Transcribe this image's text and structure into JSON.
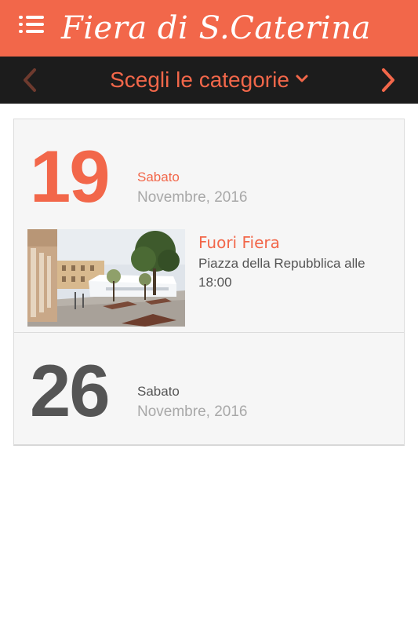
{
  "header": {
    "title": "Fiera di S.Caterina",
    "menu_icon": "menu-list-icon",
    "background_color": "#f2674a"
  },
  "category_bar": {
    "label": "Scegli le categorie",
    "prev_icon": "chevron-left-icon",
    "next_icon": "chevron-right-icon",
    "dropdown_icon": "chevron-down-icon",
    "background_color": "#1c1c1c",
    "accent_color": "#f2674a"
  },
  "dates": [
    {
      "day": "19",
      "weekday": "Sabato",
      "month_year": "Novembre, 2016",
      "events": [
        {
          "title": "Fuori Fiera",
          "description": "Piazza della Repubblica alle 18:00",
          "thumbnail": "plaza-with-tent-photo"
        }
      ]
    },
    {
      "day": "26",
      "weekday": "Sabato",
      "month_year": "Novembre, 2016",
      "events": []
    }
  ]
}
